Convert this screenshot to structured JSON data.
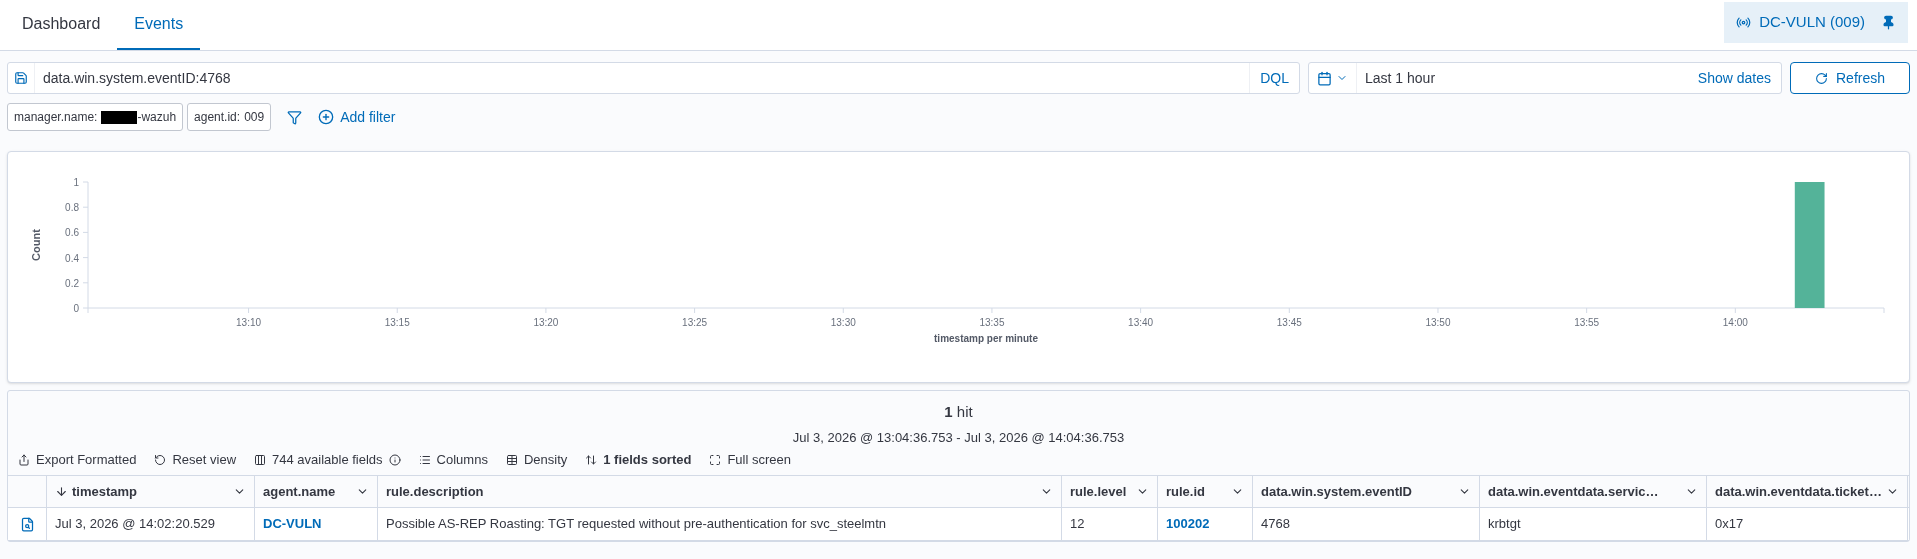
{
  "tabs": [
    {
      "label": "Dashboard",
      "selected": false
    },
    {
      "label": "Events",
      "selected": true
    }
  ],
  "agent_badge": {
    "label": "DC-VULN (009)",
    "pinned": true
  },
  "query": {
    "value": "data.win.system.eventID:4768",
    "language": "DQL"
  },
  "time_picker": {
    "value": "Last 1 hour",
    "show_dates": "Show dates",
    "refresh": "Refresh"
  },
  "filters": [
    {
      "key": "manager.name:",
      "redacted": true,
      "value": "-wazuh"
    },
    {
      "key": "agent.id:",
      "redacted": false,
      "value": "009"
    }
  ],
  "add_filter": "Add filter",
  "histogram": {
    "chart_data": {
      "type": "bar",
      "xlabel": "timestamp per minute",
      "ylabel": "Count",
      "categories": [
        null,
        null,
        null,
        null,
        null,
        "13:10",
        null,
        null,
        null,
        null,
        "13:15",
        null,
        null,
        null,
        null,
        "13:20",
        null,
        null,
        null,
        null,
        "13:25",
        null,
        null,
        null,
        null,
        "13:30",
        null,
        null,
        null,
        null,
        "13:35",
        null,
        null,
        null,
        null,
        "13:40",
        null,
        null,
        null,
        null,
        "13:45",
        null,
        null,
        null,
        null,
        "13:50",
        null,
        null,
        null,
        null,
        "13:55",
        null,
        null,
        null,
        null,
        "14:00",
        null,
        null,
        null,
        null
      ],
      "series": [
        {
          "color": "#54b399",
          "values": [
            null,
            null,
            null,
            null,
            null,
            null,
            null,
            null,
            null,
            null,
            null,
            null,
            null,
            null,
            null,
            null,
            null,
            null,
            null,
            null,
            null,
            null,
            null,
            null,
            null,
            null,
            null,
            null,
            null,
            null,
            null,
            null,
            null,
            null,
            null,
            null,
            null,
            null,
            null,
            null,
            null,
            null,
            null,
            null,
            null,
            null,
            null,
            null,
            null,
            null,
            null,
            null,
            null,
            null,
            null,
            null,
            null,
            1,
            null,
            null
          ]
        }
      ],
      "ylim": [
        0,
        1
      ],
      "yticks": [
        0,
        0.2,
        0.4,
        0.6,
        0.8,
        1
      ]
    }
  },
  "results": {
    "hits_count": "1",
    "hits_label": "hit",
    "range": "Jul 3, 2026 @ 13:04:36.753 - Jul 3, 2026 @ 14:04:36.753",
    "toolbar": [
      {
        "kind": "export",
        "label": "Export Formatted"
      },
      {
        "kind": "reset",
        "label": "Reset view"
      },
      {
        "kind": "fields",
        "label": "744 available fields"
      },
      {
        "kind": "columns",
        "label": "Columns"
      },
      {
        "kind": "density",
        "label": "Density"
      },
      {
        "kind": "sorted",
        "label": "1 fields sorted"
      },
      {
        "kind": "fullscreen",
        "label": "Full screen"
      }
    ],
    "columns": [
      {
        "label": "timestamp",
        "sorted": true
      },
      {
        "label": "agent.name",
        "sorted": false
      },
      {
        "label": "rule.description",
        "sorted": false
      },
      {
        "label": "rule.level",
        "sorted": false
      },
      {
        "label": "rule.id",
        "sorted": false
      },
      {
        "label": "data.win.system.eventID",
        "sorted": false
      },
      {
        "label": "data.win.eventdata.servic…",
        "sorted": false
      },
      {
        "label": "data.win.eventdata.ticket…",
        "sorted": false
      }
    ],
    "rows": [
      {
        "cells": [
          {
            "text": "Jul 3, 2026 @ 14:02:20.529",
            "link": false
          },
          {
            "text": "DC-VULN",
            "link": true
          },
          {
            "text": "Possible AS-REP Roasting: TGT requested without pre-authentication for svc_steelmtn",
            "link": false
          },
          {
            "text": "12",
            "link": false
          },
          {
            "text": "100202",
            "link": true
          },
          {
            "text": "4768",
            "link": false
          },
          {
            "text": "krbtgt",
            "link": false
          },
          {
            "text": "0x17",
            "link": false
          }
        ]
      }
    ]
  }
}
